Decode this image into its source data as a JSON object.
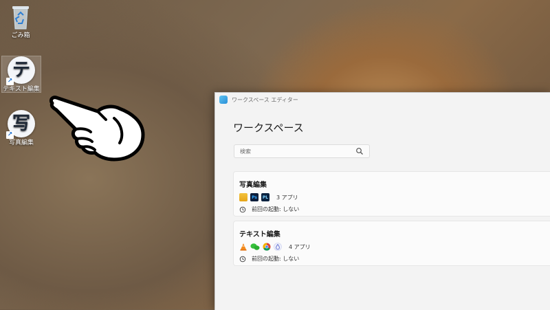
{
  "desktop": {
    "icons": [
      {
        "label": "ごみ箱",
        "glyph": ""
      },
      {
        "label": "テキスト編集",
        "glyph": "テ"
      },
      {
        "label": "写真編集",
        "glyph": "写"
      }
    ],
    "shortcut_arrow": "↗"
  },
  "window": {
    "title": "ワークスペース エディター",
    "heading": "ワークスペース",
    "search": {
      "placeholder": "検索"
    },
    "workspaces": [
      {
        "name": "写真編集",
        "apps": [
          "folder-icon",
          "photoshop-icon",
          "pl-icon"
        ],
        "app_labels": [
          "",
          "Ps",
          "PL"
        ],
        "count": "3 アプリ",
        "last_launch": "前回の起動: しない"
      },
      {
        "name": "テキスト編集",
        "apps": [
          "vlc-icon",
          "wechat-icon",
          "chrome-icon",
          "droplet-icon"
        ],
        "app_labels": [
          "",
          "",
          "",
          ""
        ],
        "count": "4 アプリ",
        "last_launch": "前回の起動: しない"
      }
    ]
  },
  "colors": {
    "window_bg": "#f3f3f3",
    "card_bg": "#fbfbfb",
    "accent": "#2a8fd8"
  }
}
